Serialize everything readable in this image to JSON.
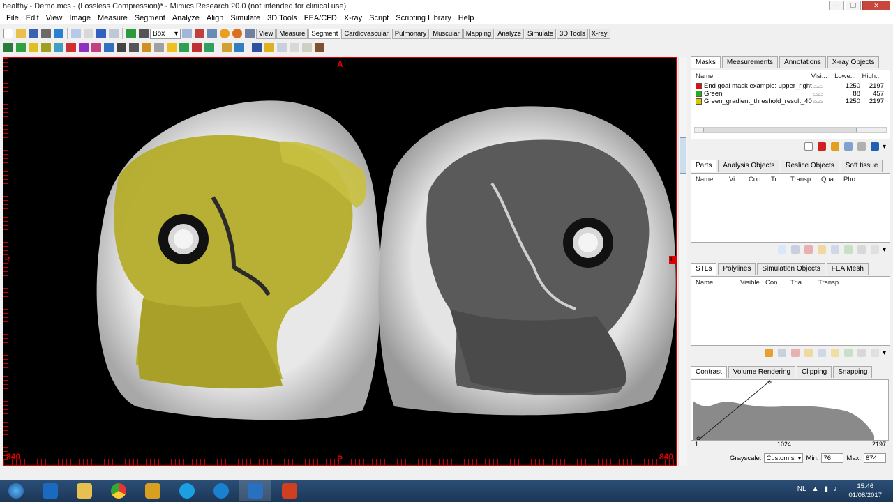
{
  "window": {
    "title": "healthy - Demo.mcs - (Lossless Compression)* - Mimics Research 20.0 (not intended for clinical use)"
  },
  "menu": [
    "File",
    "Edit",
    "View",
    "Image",
    "Measure",
    "Segment",
    "Analyze",
    "Align",
    "Simulate",
    "3D Tools",
    "FEA/CFD",
    "X-ray",
    "Script",
    "Scripting Library",
    "Help"
  ],
  "toolbar": {
    "zoom_mode": "Box",
    "tabs": [
      "View",
      "Measure",
      "Segment",
      "Cardiovascular",
      "Pulmonary",
      "Muscular",
      "Mapping",
      "Analyze",
      "Simulate",
      "3D Tools",
      "X-ray"
    ],
    "active_tab": "Segment"
  },
  "viewport": {
    "top_label": "A",
    "bottom_label": "P",
    "left_label": "R",
    "right_label": "L",
    "corner_left": "840",
    "corner_right": "840"
  },
  "masks_panel": {
    "tabs": [
      "Masks",
      "Measurements",
      "Annotations",
      "X-ray Objects"
    ],
    "headers": [
      "Name",
      "Visi...",
      "Lowe...",
      "High..."
    ],
    "rows": [
      {
        "name": "End goal mask example: upper_right",
        "low": "1250",
        "high": "2197",
        "color": "#e01010"
      },
      {
        "name": "Green",
        "low": "88",
        "high": "457",
        "color": "#20b020"
      },
      {
        "name": "Green_gradient_threshold_result_40",
        "low": "1250",
        "high": "2197",
        "color": "#d8c800"
      }
    ]
  },
  "parts_panel": {
    "tabs": [
      "Parts",
      "Analysis Objects",
      "Reslice Objects",
      "Soft tissue"
    ],
    "headers": [
      "Name",
      "Vi...",
      "Con...",
      "Tr...",
      "Transp...",
      "Qua...",
      "Pho..."
    ]
  },
  "stl_panel": {
    "tabs": [
      "STLs",
      "Polylines",
      "Simulation Objects",
      "FEA Mesh"
    ],
    "headers": [
      "Name",
      "Visible",
      "Con...",
      "Tria...",
      "Transp..."
    ]
  },
  "contrast_panel": {
    "tabs": [
      "Contrast",
      "Volume Rendering",
      "Clipping",
      "Snapping"
    ],
    "axis": [
      "1",
      "1024",
      "2197"
    ],
    "grayscale_label": "Grayscale:",
    "grayscale_value": "Custom s",
    "min_label": "Min:",
    "min_value": "76",
    "max_label": "Max:",
    "max_value": "874"
  },
  "taskbar": {
    "lang": "NL",
    "time": "15:46",
    "date": "01/08/2017"
  }
}
